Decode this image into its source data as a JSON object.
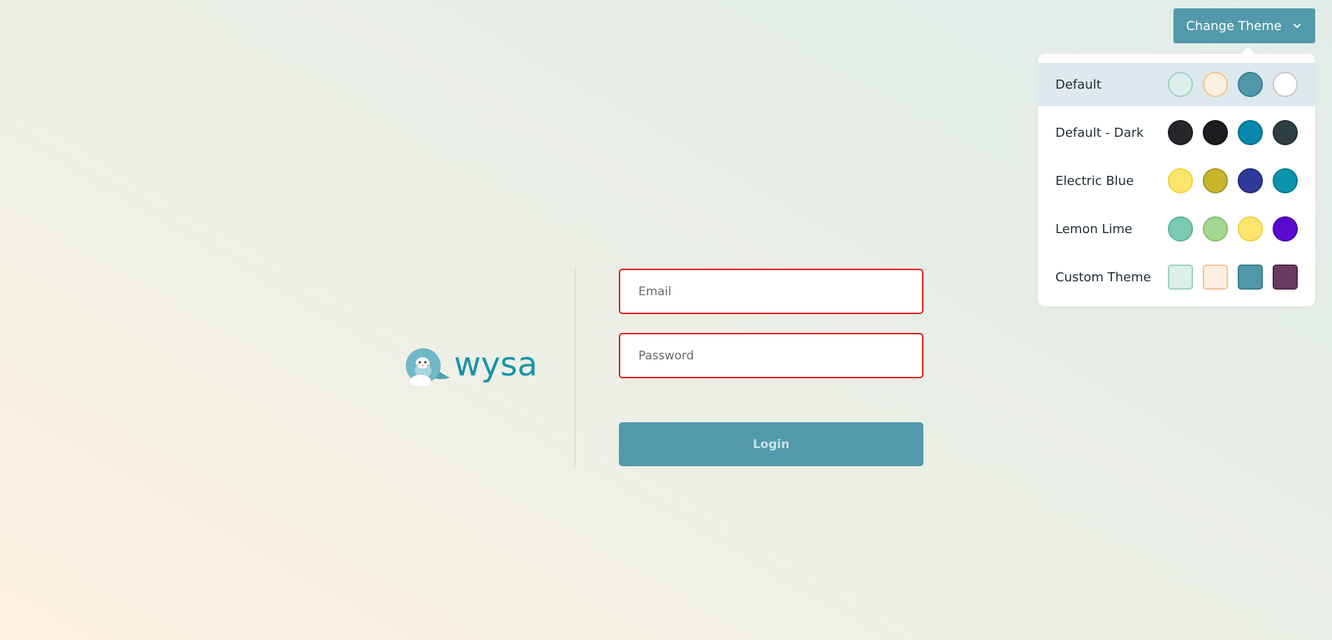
{
  "theme_button": {
    "label": "Change Theme",
    "icon": "chevron-down-icon"
  },
  "theme_menu": {
    "themes": [
      {
        "name": "Default",
        "selected": true,
        "shape": "circle",
        "colors": [
          "#dcefea",
          "#fdf0e2",
          "#4f97a9",
          "#ffffff"
        ],
        "borders": [
          "#9fd1c5",
          "#f3c48f",
          "#3a7f90",
          "#c9c9c9"
        ]
      },
      {
        "name": "Default - Dark",
        "selected": false,
        "shape": "circle",
        "colors": [
          "#25272b",
          "#1c1d21",
          "#0a87ad",
          "#2e3f43"
        ],
        "borders": [
          "#1a1b1e",
          "#111214",
          "#066f8f",
          "#223134"
        ]
      },
      {
        "name": "Electric Blue",
        "selected": false,
        "shape": "circle",
        "colors": [
          "#fbe66d",
          "#c8b52c",
          "#2e3a99",
          "#0a95ad"
        ],
        "borders": [
          "#f0d13a",
          "#a69524",
          "#232d7a",
          "#087c90"
        ]
      },
      {
        "name": "Lemon Lime",
        "selected": false,
        "shape": "circle",
        "colors": [
          "#78cab2",
          "#a7d594",
          "#fbe66d",
          "#5a0ad0"
        ],
        "borders": [
          "#5bb399",
          "#87c06e",
          "#f0d13a",
          "#4707a8"
        ]
      },
      {
        "name": "Custom Theme",
        "selected": false,
        "shape": "square",
        "colors": [
          "#dcefea",
          "#fdf0e2",
          "#4f97a9",
          "#6b3a62"
        ],
        "borders": [
          "#9fd1c5",
          "#f3c48f",
          "#3a7f90",
          "#53294b"
        ]
      }
    ]
  },
  "logo": {
    "text": "wysa"
  },
  "form": {
    "email_placeholder": "Email",
    "password_placeholder": "Password",
    "login_label": "Login"
  },
  "colors": {
    "accent": "#529aab",
    "error_border": "#e01919",
    "logo": "#1794a8"
  }
}
